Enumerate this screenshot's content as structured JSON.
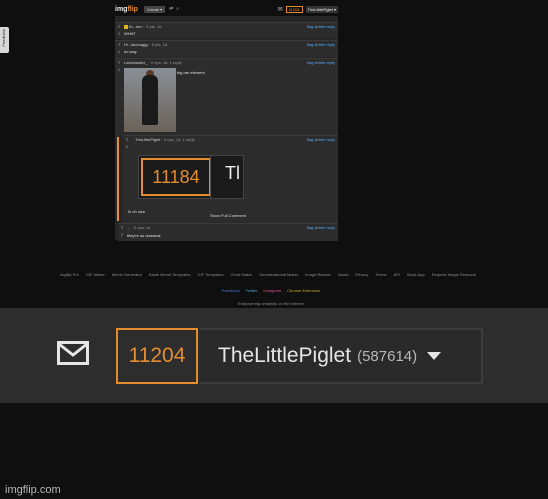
{
  "side_tab": {
    "label": "Feedback"
  },
  "topbar": {
    "logo_prefix": "img",
    "logo_suffix": "flip",
    "create_label": "Create ▾",
    "points": "11204",
    "username": "TheLittlePiglet ▾"
  },
  "comments": [
    {
      "user": "Kr...ken",
      "meta": "· 3 pts, 1d",
      "actions": "flag  delete reply",
      "text": "WHAT"
    },
    {
      "user": "Hi...lalobaggy",
      "meta": "· 6 pts, 1d",
      "actions": "flag  delete reply",
      "text": "no way"
    },
    {
      "user": "Lasertaaker_",
      "meta": "· 0 ups, 1d, 1 reply",
      "actions": "flag  delete reply",
      "text": "big ran element"
    },
    {
      "user": "TheLittlePiglet",
      "meta": "· 0 ups, 1d, 1 reply",
      "actions": "flag  delete reply",
      "text": "hi oh nice"
    },
    {
      "user": "...",
      "meta": "· 0 ups, 1d",
      "actions": "flag  delete reply",
      "text": "they're so classical"
    }
  ],
  "zoom_preview": {
    "points": "11184",
    "name_fragment": "Tl"
  },
  "show_full_comment": "Show Full Comment",
  "footer": {
    "links": [
      "imgflip Pro",
      "GIF Maker",
      "Meme Generator",
      "Blank Meme Templates",
      "GIF Templates",
      "Chart Maker",
      "Demotivational Maker",
      "Image Resizer",
      "About",
      "Privacy",
      "Terms",
      "API",
      "Slack App",
      "Request Image Removal"
    ],
    "social": [
      "Facebook",
      "Twitter",
      "Instagram",
      "Chrome Extension"
    ],
    "copyright": "Empowering creativity on the internet"
  },
  "zoomed_bar": {
    "points": "11204",
    "username": "TheLittlePiglet",
    "score": "(587614)"
  },
  "watermark": "imgflip.com",
  "colors": {
    "accent": "#e58c2e",
    "background": "#0f0f0f",
    "bar": "#2d2d2d"
  }
}
